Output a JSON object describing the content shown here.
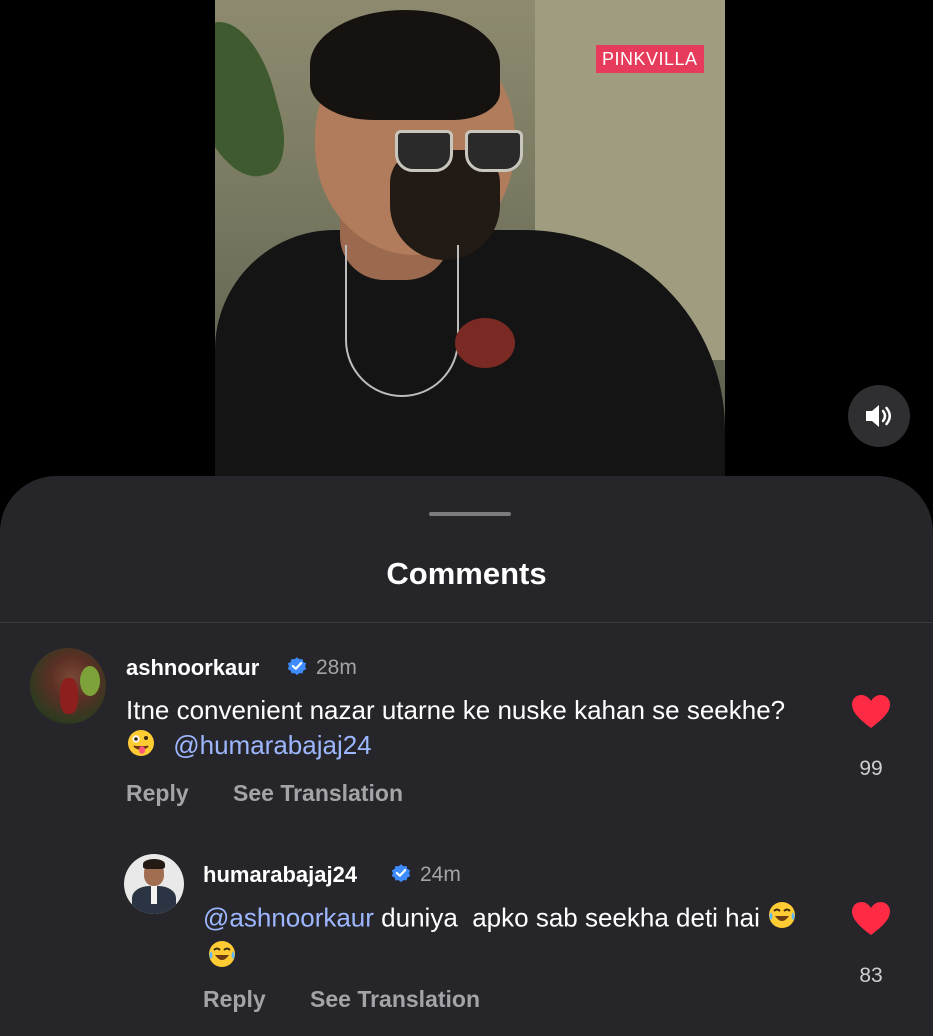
{
  "video": {
    "watermark": "PINKVILLA"
  },
  "controls": {
    "volume_icon": "speaker-volume-icon"
  },
  "sheet": {
    "title": "Comments"
  },
  "comments": [
    {
      "username": "ashnoorkaur",
      "verified": true,
      "time": "28m",
      "text_before": "Itne convenient nazar utarne ke nuske kahan se seekhe?",
      "emojis": [
        "zany-face-emoji"
      ],
      "mention": "@humarabajaj24",
      "text_after": "",
      "reply_label": "Reply",
      "translate_label": "See Translation",
      "likes": "99",
      "liked": true
    },
    {
      "username": "humarabajaj24",
      "verified": true,
      "time": "24m",
      "mention": "@ashnoorkaur",
      "text": " duniya  apko sab seekha deti hai ",
      "emojis": [
        "laughing-tears-emoji",
        "laughing-tears-emoji"
      ],
      "reply_label": "Reply",
      "translate_label": "See Translation",
      "likes": "83",
      "liked": true
    }
  ],
  "colors": {
    "sheet_bg": "#26262a",
    "heart": "#ff2a44",
    "mention": "#9db7ff",
    "verified": "#3f8cff",
    "watermark_bg": "#e63b5b"
  }
}
